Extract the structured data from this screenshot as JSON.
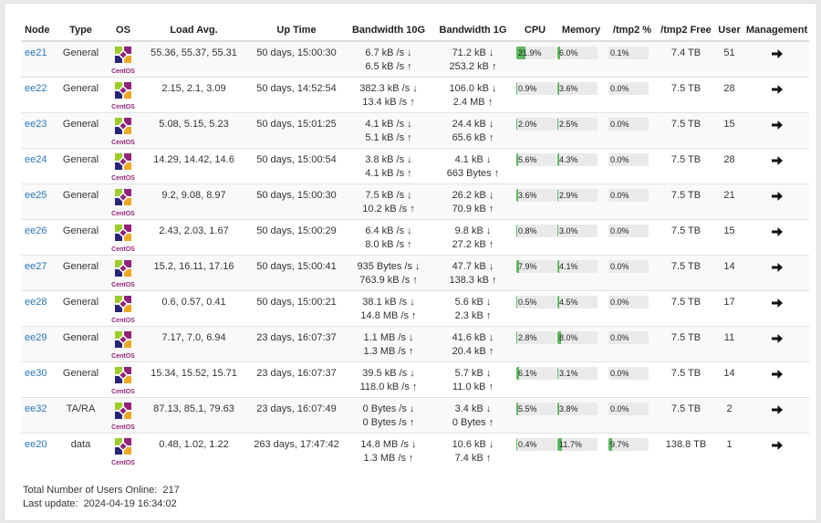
{
  "columns": [
    "Node",
    "Type",
    "OS",
    "Load Avg.",
    "Up Time",
    "Bandwidth 10G",
    "Bandwidth 1G",
    "CPU",
    "Memory",
    "/tmp2 %",
    "/tmp2 Free",
    "User",
    "Management"
  ],
  "os_logo_text": "CentOS",
  "colors": {
    "bar_fill": "#5cb85c",
    "link": "#2a76b8",
    "bar_bg": "#eaeaea"
  },
  "rows": [
    {
      "node": "ee21",
      "type": "General",
      "load": "55.36, 55.37, 55.31",
      "uptime": "50 days, 15:00:30",
      "bw10_down": "6.7 kB /s ↓",
      "bw10_up": "6.5 kB /s ↑",
      "bw1_down": "71.2 kB ↓",
      "bw1_up": "253.2 kB ↑",
      "cpu": "21.9%",
      "cpu_pct": 21.9,
      "mem": "6.0%",
      "mem_pct": 6.0,
      "tmp": "0.1%",
      "tmp_pct": 0.1,
      "tmp_free": "7.4 TB",
      "users": "51"
    },
    {
      "node": "ee22",
      "type": "General",
      "load": "2.15, 2.1, 3.09",
      "uptime": "50 days, 14:52:54",
      "bw10_down": "382.3 kB /s ↓",
      "bw10_up": "13.4 kB /s ↑",
      "bw1_down": "106.0 kB ↓",
      "bw1_up": "2.4 MB ↑",
      "cpu": "0.9%",
      "cpu_pct": 0.9,
      "mem": "3.6%",
      "mem_pct": 3.6,
      "tmp": "0.0%",
      "tmp_pct": 0.0,
      "tmp_free": "7.5 TB",
      "users": "28"
    },
    {
      "node": "ee23",
      "type": "General",
      "load": "5.08, 5.15, 5.23",
      "uptime": "50 days, 15:01:25",
      "bw10_down": "4.1 kB /s ↓",
      "bw10_up": "5.1 kB /s ↑",
      "bw1_down": "24.4 kB ↓",
      "bw1_up": "65.6 kB ↑",
      "cpu": "2.0%",
      "cpu_pct": 2.0,
      "mem": "2.5%",
      "mem_pct": 2.5,
      "tmp": "0.0%",
      "tmp_pct": 0.0,
      "tmp_free": "7.5 TB",
      "users": "15"
    },
    {
      "node": "ee24",
      "type": "General",
      "load": "14.29, 14.42, 14.6",
      "uptime": "50 days, 15:00:54",
      "bw10_down": "3.8 kB /s ↓",
      "bw10_up": "4.1 kB /s ↑",
      "bw1_down": "4.1 kB ↓",
      "bw1_up": "663 Bytes ↑",
      "cpu": "5.6%",
      "cpu_pct": 5.6,
      "mem": "4.3%",
      "mem_pct": 4.3,
      "tmp": "0.0%",
      "tmp_pct": 0.0,
      "tmp_free": "7.5 TB",
      "users": "28"
    },
    {
      "node": "ee25",
      "type": "General",
      "load": "9.2, 9.08, 8.97",
      "uptime": "50 days, 15:00:30",
      "bw10_down": "7.5 kB /s ↓",
      "bw10_up": "10.2 kB /s ↑",
      "bw1_down": "26.2 kB ↓",
      "bw1_up": "70.9 kB ↑",
      "cpu": "3.6%",
      "cpu_pct": 3.6,
      "mem": "2.9%",
      "mem_pct": 2.9,
      "tmp": "0.0%",
      "tmp_pct": 0.0,
      "tmp_free": "7.5 TB",
      "users": "21"
    },
    {
      "node": "ee26",
      "type": "General",
      "load": "2.43, 2.03, 1.67",
      "uptime": "50 days, 15:00:29",
      "bw10_down": "6.4 kB /s ↓",
      "bw10_up": "8.0 kB /s ↑",
      "bw1_down": "9.8 kB ↓",
      "bw1_up": "27.2 kB ↑",
      "cpu": "0.8%",
      "cpu_pct": 0.8,
      "mem": "3.0%",
      "mem_pct": 3.0,
      "tmp": "0.0%",
      "tmp_pct": 0.0,
      "tmp_free": "7.5 TB",
      "users": "15"
    },
    {
      "node": "ee27",
      "type": "General",
      "load": "15.2, 16.11, 17.16",
      "uptime": "50 days, 15:00:41",
      "bw10_down": "935 Bytes /s ↓",
      "bw10_up": "763.9 kB /s ↑",
      "bw1_down": "47.7 kB ↓",
      "bw1_up": "138.3 kB ↑",
      "cpu": "7.9%",
      "cpu_pct": 7.9,
      "mem": "4.1%",
      "mem_pct": 4.1,
      "tmp": "0.0%",
      "tmp_pct": 0.0,
      "tmp_free": "7.5 TB",
      "users": "14"
    },
    {
      "node": "ee28",
      "type": "General",
      "load": "0.6, 0.57, 0.41",
      "uptime": "50 days, 15:00:21",
      "bw10_down": "38.1 kB /s ↓",
      "bw10_up": "14.8 MB /s ↑",
      "bw1_down": "5.6 kB ↓",
      "bw1_up": "2.3 kB ↑",
      "cpu": "0.5%",
      "cpu_pct": 0.5,
      "mem": "4.5%",
      "mem_pct": 4.5,
      "tmp": "0.0%",
      "tmp_pct": 0.0,
      "tmp_free": "7.5 TB",
      "users": "17"
    },
    {
      "node": "ee29",
      "type": "General",
      "load": "7.17, 7.0, 6.94",
      "uptime": "23 days, 16:07:37",
      "bw10_down": "1.1 MB /s ↓",
      "bw10_up": "1.3 MB /s ↑",
      "bw1_down": "41.6 kB ↓",
      "bw1_up": "20.4 kB ↑",
      "cpu": "2.8%",
      "cpu_pct": 2.8,
      "mem": "8.0%",
      "mem_pct": 8.0,
      "tmp": "0.0%",
      "tmp_pct": 0.0,
      "tmp_free": "7.5 TB",
      "users": "11"
    },
    {
      "node": "ee30",
      "type": "General",
      "load": "15.34, 15.52, 15.71",
      "uptime": "23 days, 16:07:37",
      "bw10_down": "39.5 kB /s ↓",
      "bw10_up": "118.0 kB /s ↑",
      "bw1_down": "5.7 kB ↓",
      "bw1_up": "11.0 kB ↑",
      "cpu": "6.1%",
      "cpu_pct": 6.1,
      "mem": "3.1%",
      "mem_pct": 3.1,
      "tmp": "0.0%",
      "tmp_pct": 0.0,
      "tmp_free": "7.5 TB",
      "users": "14"
    },
    {
      "node": "ee32",
      "type": "TA/RA",
      "load": "87.13, 85.1, 79.63",
      "uptime": "23 days, 16:07:49",
      "bw10_down": "0 Bytes /s ↓",
      "bw10_up": "0 Bytes /s ↑",
      "bw1_down": "3.4 kB ↓",
      "bw1_up": "0 Bytes ↑",
      "cpu": "5.5%",
      "cpu_pct": 5.5,
      "mem": "3.8%",
      "mem_pct": 3.8,
      "tmp": "0.0%",
      "tmp_pct": 0.0,
      "tmp_free": "7.5 TB",
      "users": "2"
    },
    {
      "node": "ee20",
      "type": "data",
      "load": "0.48, 1.02, 1.22",
      "uptime": "263 days, 17:47:42",
      "bw10_down": "14.8 MB /s ↓",
      "bw10_up": "1.3 MB /s ↑",
      "bw1_down": "10.6 kB ↓",
      "bw1_up": "7.4 kB ↑",
      "cpu": "0.4%",
      "cpu_pct": 0.4,
      "mem": "11.7%",
      "mem_pct": 11.7,
      "tmp": "9.7%",
      "tmp_pct": 9.7,
      "tmp_free": "138.8 TB",
      "users": "1"
    }
  ],
  "footer": {
    "users_label": "Total Number of Users Online:",
    "users_value": "217",
    "update_label": "Last update:",
    "update_value": "2024-04-19 16:34:02"
  }
}
